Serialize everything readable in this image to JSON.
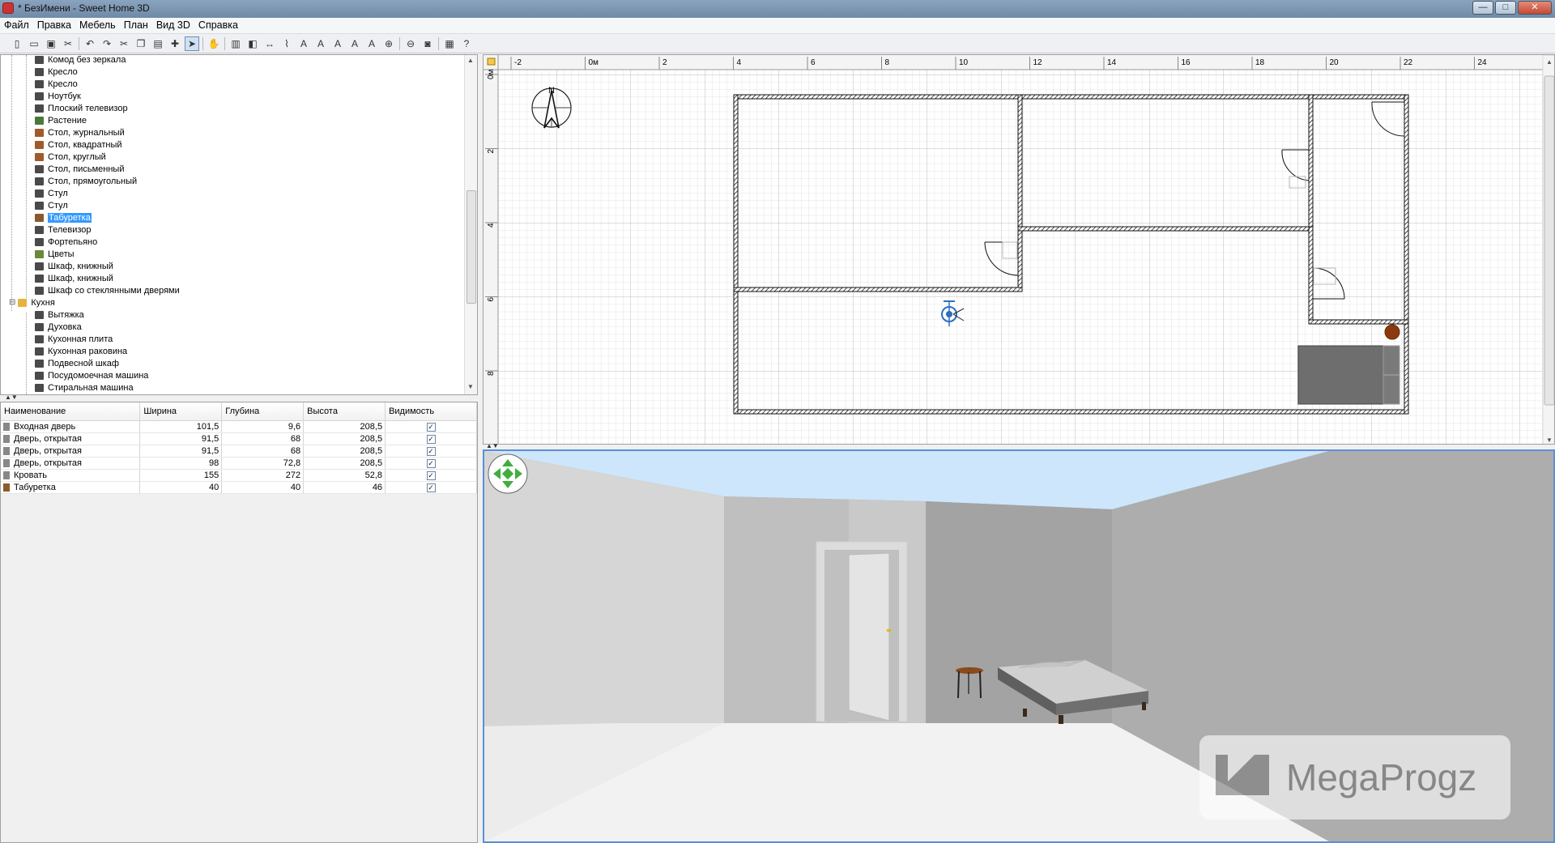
{
  "window": {
    "title": "* БезИмени - Sweet Home 3D",
    "minimize": "—",
    "maximize": "□",
    "close": "✕"
  },
  "menu": [
    "Файл",
    "Правка",
    "Мебель",
    "План",
    "Вид 3D",
    "Справка"
  ],
  "toolbar_icons": [
    "new-icon",
    "open-icon",
    "save-icon",
    "cut-tool-icon",
    "undo-icon",
    "redo-icon",
    "cut-icon",
    "copy-icon",
    "paste-icon",
    "add-furniture-icon",
    "select-mode-icon",
    "pan-mode-icon",
    "create-walls-icon",
    "create-rooms-icon",
    "create-dimensions-icon",
    "create-polylines-icon",
    "add-text-icon",
    "text-style-a-icon",
    "text-style-b-icon",
    "text-style-c-icon",
    "text-style-d-icon",
    "zoom-in-icon",
    "zoom-out-icon",
    "create-photo-icon",
    "create-video-icon",
    "help-icon"
  ],
  "catalog": {
    "items": [
      {
        "label": "Комод без зеркала",
        "icon": "dresser-icon"
      },
      {
        "label": "Кресло",
        "icon": "armchair-icon"
      },
      {
        "label": "Кресло",
        "icon": "armchair-icon"
      },
      {
        "label": "Ноутбук",
        "icon": "laptop-icon"
      },
      {
        "label": "Плоский телевизор",
        "icon": "flat-tv-icon"
      },
      {
        "label": "Растение",
        "icon": "plant-icon"
      },
      {
        "label": "Стол, журнальный",
        "icon": "coffee-table-icon"
      },
      {
        "label": "Стол, квадратный",
        "icon": "square-table-icon"
      },
      {
        "label": "Стол, круглый",
        "icon": "round-table-icon"
      },
      {
        "label": "Стол, письменный",
        "icon": "desk-icon"
      },
      {
        "label": "Стол, прямоугольный",
        "icon": "rect-table-icon"
      },
      {
        "label": "Стул",
        "icon": "chair-icon"
      },
      {
        "label": "Стул",
        "icon": "chair-icon"
      },
      {
        "label": "Табуретка",
        "icon": "stool-icon",
        "selected": true
      },
      {
        "label": "Телевизор",
        "icon": "tv-icon"
      },
      {
        "label": "Фортепьяно",
        "icon": "piano-icon"
      },
      {
        "label": "Цветы",
        "icon": "flowers-icon"
      },
      {
        "label": "Шкаф, книжный",
        "icon": "bookcase-icon"
      },
      {
        "label": "Шкаф, книжный",
        "icon": "bookcase-icon"
      },
      {
        "label": "Шкаф со стеклянными дверями",
        "icon": "glass-cabinet-icon"
      },
      {
        "label": "Кухня",
        "icon": "folder-icon",
        "category": true
      },
      {
        "label": "Вытяжка",
        "icon": "hood-icon"
      },
      {
        "label": "Духовка",
        "icon": "oven-icon"
      },
      {
        "label": "Кухонная плита",
        "icon": "cooker-icon"
      },
      {
        "label": "Кухонная раковина",
        "icon": "sink-icon"
      },
      {
        "label": "Подвесной шкаф",
        "icon": "wall-cabinet-icon"
      },
      {
        "label": "Посудомоечная машина",
        "icon": "dishwasher-icon"
      },
      {
        "label": "Стиральная машина",
        "icon": "washer-icon"
      }
    ]
  },
  "furniture_table": {
    "headers": [
      "Наименование",
      "Ширина",
      "Глубина",
      "Высота",
      "Видимость"
    ],
    "rows": [
      {
        "name": "Входная дверь",
        "width": "101,5",
        "depth": "9,6",
        "height": "208,5",
        "visible": true
      },
      {
        "name": "Дверь, открытая",
        "width": "91,5",
        "depth": "68",
        "height": "208,5",
        "visible": true
      },
      {
        "name": "Дверь, открытая",
        "width": "91,5",
        "depth": "68",
        "height": "208,5",
        "visible": true
      },
      {
        "name": "Дверь, открытая",
        "width": "98",
        "depth": "72,8",
        "height": "208,5",
        "visible": true
      },
      {
        "name": "Кровать",
        "width": "155",
        "depth": "272",
        "height": "52,8",
        "visible": true
      },
      {
        "name": "Табуретка",
        "width": "40",
        "depth": "40",
        "height": "46",
        "visible": true
      }
    ]
  },
  "plan": {
    "ruler_x": [
      "-2",
      "0м",
      "2",
      "4",
      "6",
      "8",
      "10",
      "12",
      "14",
      "16",
      "18",
      "20",
      "22",
      "24"
    ],
    "ruler_y": [
      "0м",
      "2",
      "4",
      "6",
      "8"
    ],
    "compass_label": "N"
  },
  "watermark": {
    "text": "MegaProgz"
  },
  "colors": {
    "selection": "#3399ff",
    "view3d_border": "#5b8fd6",
    "sky": "#cde6fb",
    "wall": "#a9a9a9"
  }
}
